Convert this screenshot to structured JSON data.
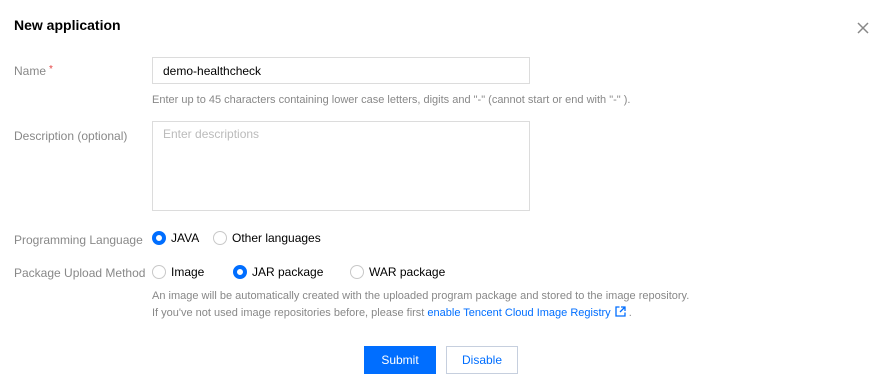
{
  "dialog": {
    "title": "New application",
    "close_icon": "close-icon"
  },
  "form": {
    "name": {
      "label": "Name",
      "required_mark": "*",
      "value": "demo-healthcheck",
      "hint": "Enter up to 45 characters containing lower case letters, digits and \"-\" (cannot start or end with \"-\" )."
    },
    "description": {
      "label": "Description (optional)",
      "placeholder": "Enter descriptions",
      "value": ""
    },
    "language": {
      "label": "Programming Language",
      "options": [
        "JAVA",
        "Other languages"
      ],
      "selected": "JAVA"
    },
    "upload": {
      "label": "Package Upload Method",
      "options": [
        "Image",
        "JAR package",
        "WAR package"
      ],
      "selected": "JAR package",
      "note_line1": "An image will be automatically created with the uploaded program package and stored to the image repository.",
      "note_line2_prefix": "If you've not used image repositories before, please first ",
      "note_link": "enable Tencent Cloud Image Registry",
      "note_suffix": " ."
    }
  },
  "buttons": {
    "submit": "Submit",
    "disable": "Disable"
  },
  "colors": {
    "accent": "#006eff",
    "required": "#e54545",
    "label": "#888888",
    "border": "#dcdcdc"
  }
}
